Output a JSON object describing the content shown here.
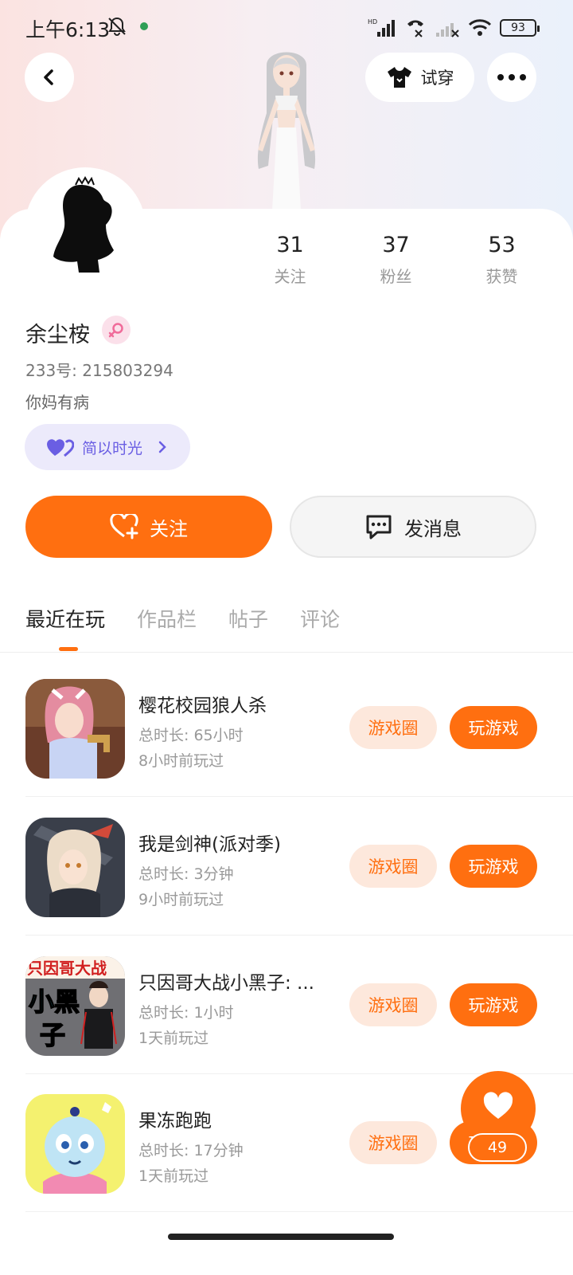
{
  "status_bar": {
    "time": "上午6:13",
    "battery": "93",
    "network_badge": "HD"
  },
  "header": {
    "tryon_label": "试穿"
  },
  "profile": {
    "stats": [
      {
        "value": "31",
        "label": "关注"
      },
      {
        "value": "37",
        "label": "粉丝"
      },
      {
        "value": "53",
        "label": "获赞"
      }
    ],
    "name": "余尘桉",
    "gender": "female",
    "uid": "233号: 215803294",
    "bio": "你妈有病",
    "guild": "简以时光"
  },
  "actions": {
    "follow_label": "关注",
    "message_label": "发消息"
  },
  "tabs": [
    {
      "label": "最近在玩",
      "active": true
    },
    {
      "label": "作品栏",
      "active": false
    },
    {
      "label": "帖子",
      "active": false
    },
    {
      "label": "评论",
      "active": false
    }
  ],
  "games": [
    {
      "title": "樱花校园狼人杀",
      "duration": "总时长: 65小时",
      "last_played": "8小时前玩过",
      "circle_label": "游戏圈",
      "play_label": "玩游戏"
    },
    {
      "title": "我是剑神(派对季)",
      "duration": "总时长: 3分钟",
      "last_played": "9小时前玩过",
      "circle_label": "游戏圈",
      "play_label": "玩游戏"
    },
    {
      "title": "只因哥大战小黑子: ...",
      "duration": "总时长: 1小时",
      "last_played": "1天前玩过",
      "circle_label": "游戏圈",
      "play_label": "玩游戏"
    },
    {
      "title": "果冻跑跑",
      "duration": "总时长: 17分钟",
      "last_played": "1天前玩过",
      "circle_label": "游戏圈",
      "play_label": "玩游戏"
    }
  ],
  "game3_icon_text": {
    "line1": "只因哥大战",
    "line2": "小黑",
    "line3": "子"
  },
  "floating_like": {
    "count": "49"
  },
  "colors": {
    "accent": "#ff6f10",
    "accent_light": "#fde8dc",
    "guild": "#6a5ee3"
  }
}
